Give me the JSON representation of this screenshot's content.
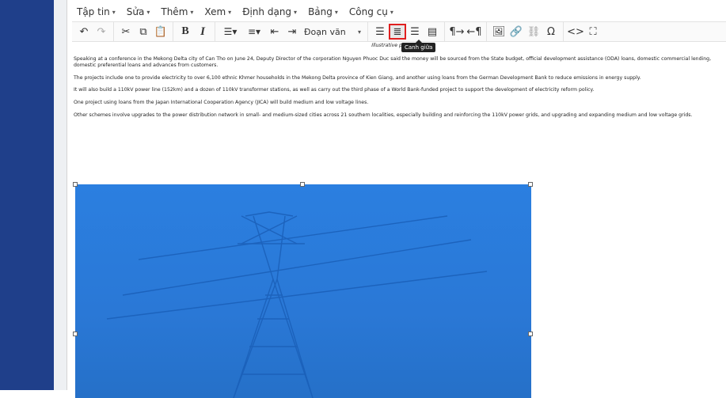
{
  "menu": [
    "Tập tin",
    "Sửa",
    "Thêm",
    "Xem",
    "Định dạng",
    "Bảng",
    "Công cụ"
  ],
  "toolbar": {
    "format_select": "Đoạn văn",
    "tooltip": "Canh giữa"
  },
  "content": {
    "caption": "Illustrative photo (VNA)",
    "paragraphs": [
      "Speaking at a conference in the Mekong Delta city of Can Tho on June 24, Deputy Director of the corporation Nguyen Phuoc Duc said the money will be sourced from the State budget, official development assistance (ODA) loans, domestic commercial lending, domestic preferential loans and advances from customers.",
      "The projects include one to provide electricity to over 6,100 ethnic Khmer households in the Mekong Delta province of Kien Giang, and another using loans from the German Development Bank to reduce emissions in energy supply.",
      "It will also build a 110kV power line (152km) and a dozen of 110kV transformer stations, as well as carry out the third phase of a World Bank-funded project to support the development of electricity reform policy.",
      "One project using loans from the Japan International Cooperation Agency (JICA) will build medium and low voltage lines.",
      "Other schemes involve upgrades to the power distribution network in small- and medium-sized cities across 21 southern localities, especially building and reinforcing the 110kV power grids, and upgrading and expanding medium and low voltage grids."
    ]
  }
}
